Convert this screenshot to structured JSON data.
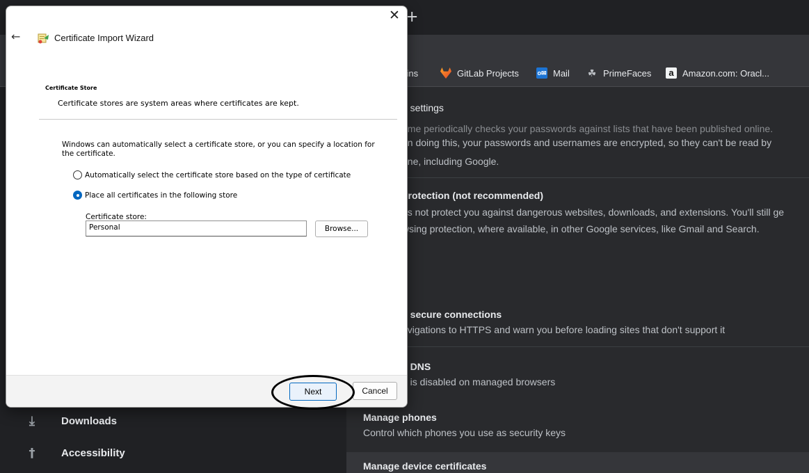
{
  "browser": {
    "new_tab_symbol": "+",
    "bookmarks": [
      {
        "label": "kins",
        "icon": "jenkins-icon"
      },
      {
        "label": "GitLab Projects",
        "icon": "gitlab-icon"
      },
      {
        "label": "Mail",
        "icon": "outlook-icon",
        "icon_text": "o✉"
      },
      {
        "label": "PrimeFaces",
        "icon": "primefaces-icon",
        "icon_text": "☘"
      },
      {
        "label": "Amazon.com: Oracl...",
        "icon": "amazon-icon",
        "icon_text": "a"
      }
    ]
  },
  "sidebar": {
    "items": [
      {
        "label": "Downloads",
        "icon": "download-icon",
        "glyph": "⤓"
      },
      {
        "label": "Accessibility",
        "icon": "accessibility-icon",
        "glyph": "†"
      }
    ]
  },
  "settings": {
    "search_text": "h settings",
    "cut_text": "ome periodically checks your passwords against lists that have been published online.",
    "password_text_1": "en doing this, your passwords and usernames are encrypted, so they can't be read by",
    "password_text_2": "one, including Google.",
    "no_protection_title": "protection (not recommended)",
    "no_protection_sub_1": "es not protect you against dangerous websites, downloads, and extensions. You'll still ge",
    "no_protection_sub_2": "wsing protection, where available, in other Google services, like Gmail and Search.",
    "secure_title": "e secure connections",
    "secure_sub": "avigations to HTTPS and warn you before loading sites that don't support it",
    "dns_title": "e DNS",
    "dns_sub": "g is disabled on managed browsers",
    "phones_title": "Manage phones",
    "phones_sub": "Control which phones you use as security keys",
    "certs_title": "Manage device certificates"
  },
  "dialog": {
    "title": "Certificate Import Wizard",
    "close_symbol": "✕",
    "back_symbol": "←",
    "section_header": "Certificate Store",
    "section_desc": "Certificate stores are system areas where certificates are kept.",
    "paragraph": "Windows can automatically select a certificate store, or you can specify a location for the certificate.",
    "radio_auto": "Automatically select the certificate store based on the type of certificate",
    "radio_place": "Place all certificates in the following store",
    "radio_selected": "place",
    "store_label": "Certificate store:",
    "store_value": "Personal",
    "browse_label": "Browse...",
    "next_label": "Next",
    "cancel_label": "Cancel",
    "accent_color": "#0067c0"
  }
}
